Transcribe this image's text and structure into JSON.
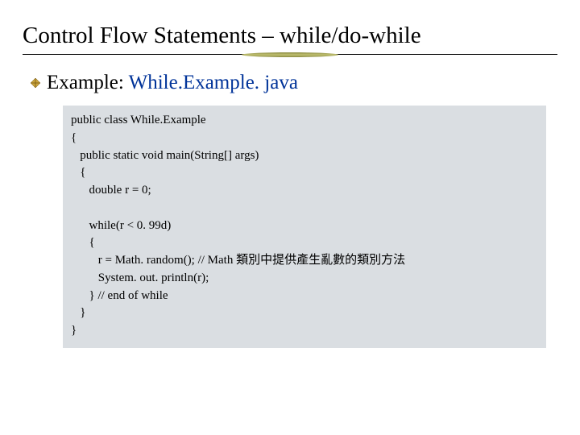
{
  "title": "Control Flow Statements – while/do-while",
  "bullet": {
    "prefix": "Example: ",
    "filename": "While.Example. java"
  },
  "code": {
    "l1": "public class While.Example",
    "l2": "{",
    "l3": "   public static void main(String[] args)",
    "l4": "   {",
    "l5": "      double r = 0;",
    "l6": "",
    "l7": "      while(r < 0. 99d)",
    "l8": "      {",
    "l9": "         r = Math. random(); // Math 類別中提供產生亂數的類別方法",
    "l10": "         System. out. println(r);",
    "l11": "      } // end of while",
    "l12": "   }",
    "l13": "}"
  }
}
